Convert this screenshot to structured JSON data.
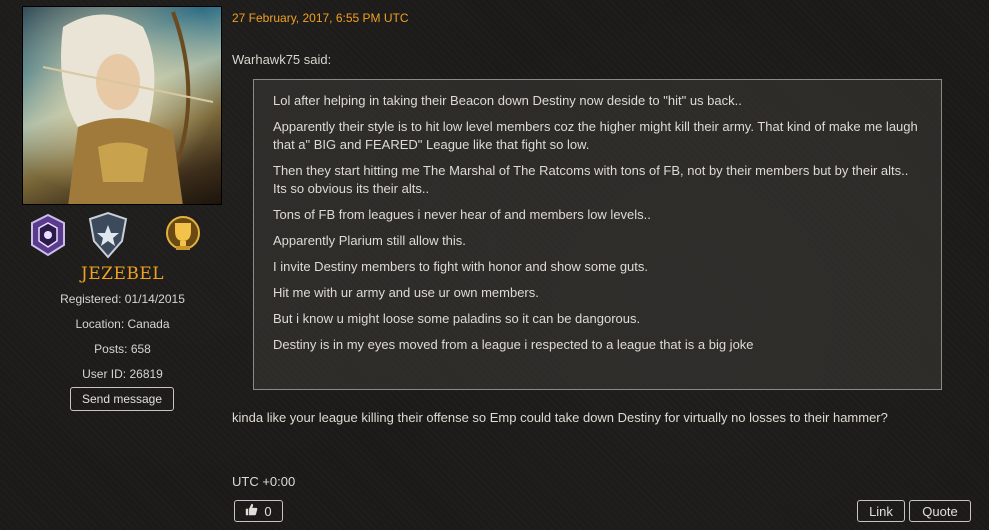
{
  "user": {
    "name": "JEZEBEL",
    "registered": "Registered: 01/14/2015",
    "location": "Location: Canada",
    "posts": "Posts: 658",
    "user_id": "User ID: 26819",
    "send_message": "Send message"
  },
  "post": {
    "date": "27 February, 2017, 6:55 PM UTC",
    "quote_author": "Warhawk75 said:",
    "quote_lines": [
      "Lol after helping in taking their Beacon down Destiny now deside to \"hit\" us back..",
      "Apparently their style is to hit low level members coz the higher might kill their army. That kind of make me laugh that a\" BIG and  FEARED\" League like that fight so low.",
      "Then they start hitting me The Marshal of The Ratcoms with tons of FB, not by their members but by their alts.. Its so obvious its their alts..",
      "Tons of FB from leagues i never hear of and members low levels..",
      "Apparently Plarium still allow this.",
      "I invite Destiny members to fight with honor and show some guts.",
      "Hit me with ur army and use ur own members.",
      "But i know u might loose some paladins so it can be dangorous.",
      "Destiny is in my eyes moved from a league i respected to a league that is a big joke"
    ],
    "reply": "kinda like your league killing their offense so Emp could take down Destiny for virtually no losses to their hammer?",
    "timezone": "UTC +0:00"
  },
  "actions": {
    "like_count": "0",
    "link_label": "Link",
    "quote_label": "Quote"
  },
  "colors": {
    "accent": "#f0a020",
    "background": "#1b1a18",
    "text": "#d8d5cf"
  },
  "icons": {
    "like": "thumbs-up-icon",
    "badges": [
      "purple-shield-badge-icon",
      "silver-star-rank-badge-icon",
      "gold-trophy-badge-icon"
    ]
  }
}
